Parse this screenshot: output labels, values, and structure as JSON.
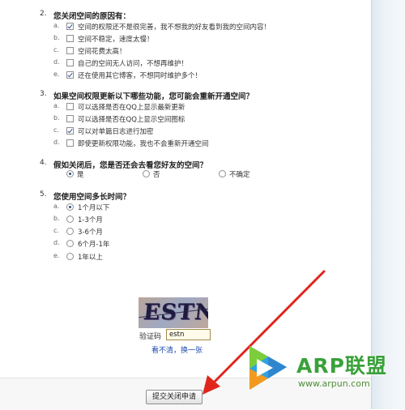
{
  "questions": [
    {
      "number": "2.",
      "text": "您关闭空间的原因有：",
      "options": [
        {
          "letter": "a.",
          "text": "空间的权限还不是很完善，我不想我的好友看到我的空间内容！",
          "checked": true
        },
        {
          "letter": "b.",
          "text": "空间不稳定，速度太慢！",
          "checked": false
        },
        {
          "letter": "c.",
          "text": "空间花费太高！",
          "checked": false
        },
        {
          "letter": "d.",
          "text": "自己的空间无人访问，不想再维护！",
          "checked": false
        },
        {
          "letter": "e.",
          "text": "还在使用其它博客，不想同时维护多个！",
          "checked": true
        }
      ]
    },
    {
      "number": "3.",
      "text": "如果空间权限更新以下哪些功能，您可能会重新开通空间？",
      "options": [
        {
          "letter": "a.",
          "text": "可以选择是否在QQ上显示最新更新",
          "checked": false
        },
        {
          "letter": "b.",
          "text": "可以选择是否在QQ上显示空间图标",
          "checked": false
        },
        {
          "letter": "c.",
          "text": "可以对单篇日志进行加密",
          "checked": true
        },
        {
          "letter": "d.",
          "text": "即使更新权限功能，我也不会重新开通空间",
          "checked": false
        }
      ]
    },
    {
      "number": "4.",
      "text": "假如关闭后，您是否还会去看您好友的空间？",
      "options": [
        {
          "text": "是",
          "selected": true
        },
        {
          "text": "否",
          "selected": false
        },
        {
          "text": "不确定",
          "selected": false
        }
      ]
    },
    {
      "number": "5.",
      "text": "您使用空间多长时间？",
      "options": [
        {
          "letter": "a.",
          "text": "1个月以下",
          "selected": true
        },
        {
          "letter": "b.",
          "text": "1-3个月",
          "selected": false
        },
        {
          "letter": "c.",
          "text": "3-6个月",
          "selected": false
        },
        {
          "letter": "d.",
          "text": "6个月-1年",
          "selected": false
        },
        {
          "letter": "e.",
          "text": "1年以上",
          "selected": false
        }
      ]
    }
  ],
  "captcha": {
    "image_text": "ESTN",
    "label": "验证码",
    "value": "estn",
    "refresh_link": "看不清，换一张"
  },
  "submit_label": "提交关闭申请",
  "watermark": {
    "title": "ARP联盟",
    "url": "www.arpun.com"
  },
  "colors": {
    "link": "#1d49b5",
    "arrow": "#e0261c",
    "watermark_green": "#3aa13a"
  }
}
